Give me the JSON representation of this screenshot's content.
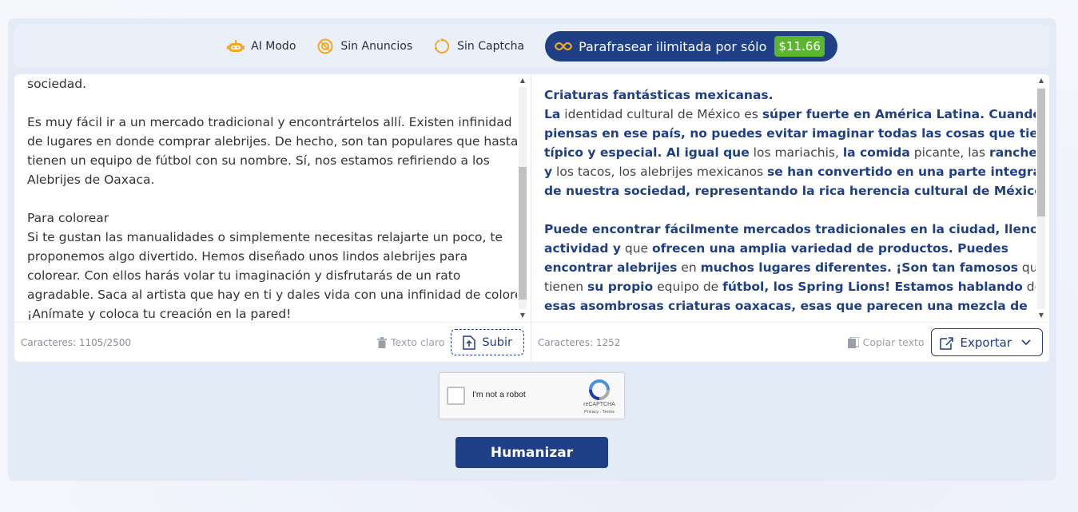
{
  "features": {
    "ai_mode": "AI Modo",
    "no_ads": "Sin Anuncios",
    "no_captcha": "Sin Captcha"
  },
  "promo": {
    "label": "Parafrasear ilimitada por sólo",
    "price": "$11.66"
  },
  "input_panel": {
    "lines": [
      "sociedad.",
      "",
      "Es muy fácil ir a un mercado tradicional y encontrártelos allí. Existen infinidad",
      "de lugares en donde comprar alebrijes. De hecho, son tan populares que hasta",
      "tienen un equipo de fútbol con su nombre. Sí, nos estamos refiriendo a los",
      "Alebrijes de Oaxaca.",
      "",
      "Para colorear",
      "Si te gustan las manualidades o simplemente necesitas relajarte un poco, te",
      "proponemos algo divertido. Hemos diseñado unos lindos alebrijes para",
      "colorear. Con ellos harás volar tu imaginación y disfrutarás de un rato",
      "agradable. Saca al artista que hay en ti y dales vida con una infinidad de colores.",
      "¡Anímate y coloca tu creación en la pared!"
    ],
    "char_count": "Caracteres: 1105/2500",
    "clear_label": "Texto claro",
    "upload_label": "Subir"
  },
  "output_panel": {
    "lines": [
      [
        {
          "t": "Criaturas fantásticas mexicanas.",
          "b": true
        }
      ],
      [
        {
          "t": "La",
          "b": true
        },
        {
          "t": " identidad cultural de México es ",
          "b": false
        },
        {
          "t": "súper fuerte en América Latina. Cuando",
          "b": true
        }
      ],
      [
        {
          "t": "piensas en ese país, no puedes evitar imaginar todas las cosas que tiene",
          "b": true
        },
        {
          "t": " de",
          "b": false
        }
      ],
      [
        {
          "t": "típico y especial. Al igual que",
          "b": true
        },
        {
          "t": " los mariachis, ",
          "b": false
        },
        {
          "t": "la comida",
          "b": true
        },
        {
          "t": " picante, las ",
          "b": false
        },
        {
          "t": "rancheras",
          "b": true
        }
      ],
      [
        {
          "t": "y",
          "b": true
        },
        {
          "t": " los tacos, los alebrijes mexicanos ",
          "b": false
        },
        {
          "t": "se han convertido en una parte integral",
          "b": true
        }
      ],
      [
        {
          "t": "de nuestra sociedad, representando la rica herencia cultural de México.",
          "b": true
        }
      ],
      [],
      [
        {
          "t": "Puede encontrar fácilmente mercados tradicionales en la ciudad, llenos de",
          "b": true
        }
      ],
      [
        {
          "t": "actividad y",
          "b": true
        },
        {
          "t": " que ",
          "b": false
        },
        {
          "t": "ofrecen una amplia variedad de productos. Puedes",
          "b": true
        }
      ],
      [
        {
          "t": "encontrar alebrijes",
          "b": true
        },
        {
          "t": " en ",
          "b": false
        },
        {
          "t": "muchos lugares diferentes. ¡Son tan famosos",
          "b": true
        },
        {
          "t": " que",
          "b": false
        }
      ],
      [
        {
          "t": "tienen ",
          "b": false
        },
        {
          "t": "su propio",
          "b": true
        },
        {
          "t": " equipo de ",
          "b": false
        },
        {
          "t": "fútbol, los Spring Lions! Estamos hablando",
          "b": true
        },
        {
          "t": " de",
          "b": false
        }
      ],
      [
        {
          "t": "esas asombrosas criaturas oaxacas, esas que parecen una mezcla de",
          "b": true
        }
      ]
    ],
    "char_count": "Caracteres: 1252",
    "copy_label": "Copiar texto",
    "export_label": "Exportar"
  },
  "captcha": {
    "label": "I'm not a robot",
    "brand": "reCAPTCHA",
    "links": "Privacy - Terms"
  },
  "humanize_label": "Humanizar",
  "colors": {
    "brand": "#1f3f86",
    "price_badge": "#5bb52d",
    "feature_icon": "#f5a623"
  }
}
